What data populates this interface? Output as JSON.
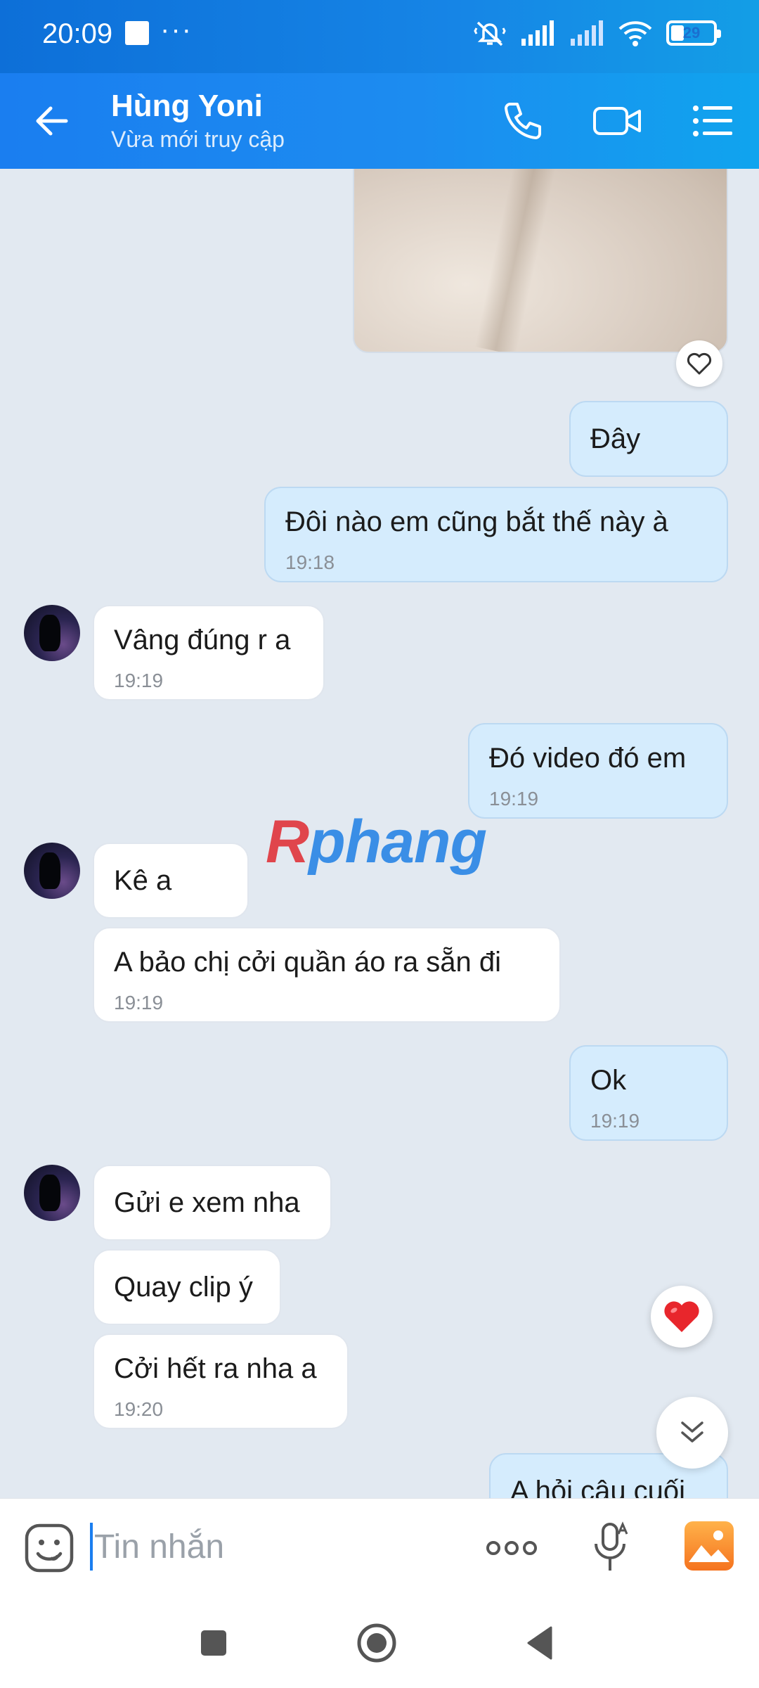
{
  "status_bar": {
    "time": "20:09",
    "dots": "···",
    "battery": "29"
  },
  "header": {
    "contact_name": "Hùng Yoni",
    "contact_status": "Vừa mới truy cập"
  },
  "watermark": {
    "part1": "R",
    "part2": "phang"
  },
  "messages": [
    {
      "side": "out",
      "text": "Đây",
      "time": ""
    },
    {
      "side": "out",
      "text": "Đôi nào em cũng bắt thế này à",
      "time": "19:18"
    },
    {
      "side": "in",
      "text": "Vâng đúng r a",
      "time": "19:19"
    },
    {
      "side": "out",
      "text": "Đó video đó em",
      "time": "19:19"
    },
    {
      "side": "in",
      "text": "Kê a",
      "time": ""
    },
    {
      "side": "in",
      "text": "A bảo chị cởi quần áo ra sẵn đi",
      "time": "19:19"
    },
    {
      "side": "out",
      "text": "Ok",
      "time": "19:19"
    },
    {
      "side": "in",
      "text": "Gửi e xem nha",
      "time": ""
    },
    {
      "side": "in",
      "text": "Quay clip ý",
      "time": ""
    },
    {
      "side": "in",
      "text": "Cởi hết ra nha a",
      "time": "19:20"
    },
    {
      "side": "out",
      "text": "A hỏi câu cuối",
      "time": ""
    }
  ],
  "input": {
    "placeholder": "Tin nhắn"
  },
  "colors": {
    "header": "#1a7ef0",
    "outgoing_bubble": "#d5ecfd",
    "incoming_bubble": "#ffffff",
    "chat_background": "#e2e9f1"
  }
}
